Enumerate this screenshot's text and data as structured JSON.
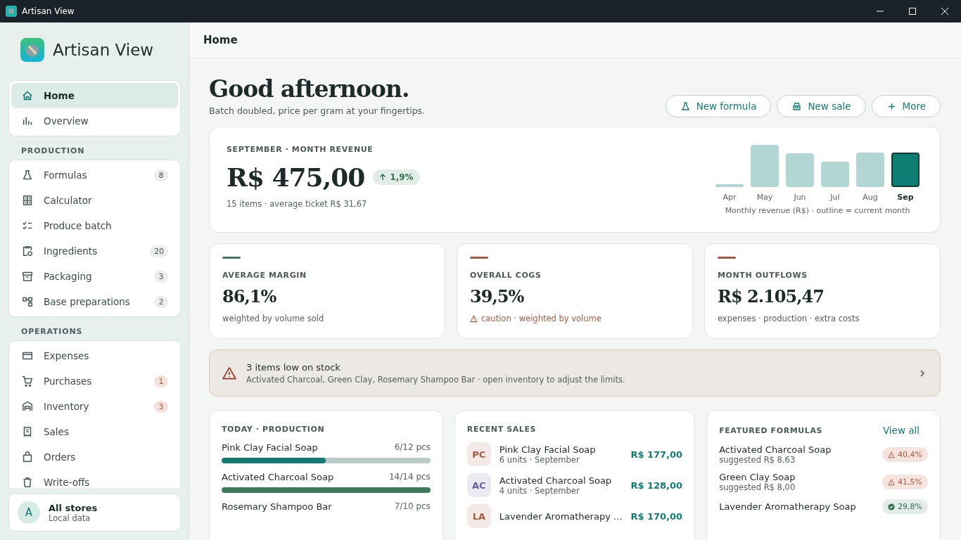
{
  "window": {
    "title": "Artisan View"
  },
  "sidebar": {
    "app_name": "Artisan View",
    "groups": [
      {
        "items": [
          {
            "label": "Home",
            "kind": "home",
            "selected": true
          },
          {
            "label": "Overview",
            "kind": "chart",
            "selected": false
          }
        ]
      },
      {
        "heading": "PRODUCTION",
        "items": [
          {
            "label": "Formulas",
            "kind": "flask",
            "selected": false,
            "count": "8",
            "alert": false
          },
          {
            "label": "Calculator",
            "kind": "calc",
            "selected": false
          },
          {
            "label": "Produce batch",
            "kind": "checklist",
            "selected": false
          },
          {
            "label": "Ingredients",
            "kind": "clipboard",
            "selected": false,
            "count": "20",
            "alert": false
          },
          {
            "label": "Packaging",
            "kind": "box",
            "selected": false,
            "count": "3",
            "alert": false
          },
          {
            "label": "Base preparations",
            "kind": "nodes",
            "selected": false,
            "count": "2",
            "alert": false
          }
        ]
      },
      {
        "heading": "OPERATIONS",
        "items": [
          {
            "label": "Expenses",
            "kind": "card",
            "selected": false
          },
          {
            "label": "Purchases",
            "kind": "cart",
            "selected": false,
            "count": "1",
            "alert": true
          },
          {
            "label": "Inventory",
            "kind": "warehouse",
            "selected": false,
            "count": "3",
            "alert": true
          },
          {
            "label": "Sales",
            "kind": "receipt",
            "selected": false
          },
          {
            "label": "Orders",
            "kind": "bag",
            "selected": false
          },
          {
            "label": "Write-offs",
            "kind": "trash",
            "selected": false
          }
        ]
      }
    ],
    "store": {
      "avatar": "A",
      "name": "All stores",
      "subtitle": "Local data"
    }
  },
  "header": {
    "title": "Home"
  },
  "greeting": {
    "title": "Good afternoon.",
    "subtitle": "Batch doubled, price per gram at your fingertips."
  },
  "actions": [
    {
      "label": "New formula",
      "kind": "flask"
    },
    {
      "label": "New sale",
      "kind": "register"
    },
    {
      "label": "More",
      "kind": "plus"
    }
  ],
  "revenue": {
    "label": "SEPTEMBER · MONTH REVENUE",
    "amount": "R$ 475,00",
    "change": "1,9%",
    "detail": "15 items · average ticket R$ 31,67",
    "months": [
      {
        "label": "Apr",
        "selected": false
      },
      {
        "label": "May",
        "selected": false
      },
      {
        "label": "Jun",
        "selected": false
      },
      {
        "label": "Jul",
        "selected": false
      },
      {
        "label": "Aug",
        "selected": false
      },
      {
        "label": "Sep",
        "selected": true
      }
    ],
    "caption": "Monthly revenue (R$) · outline = current month"
  },
  "metrics": [
    {
      "label": "AVERAGE MARGIN",
      "value": "86,1%",
      "note": "weighted by volume sold",
      "color": "#3e7a5c",
      "caution": false
    },
    {
      "label": "OVERALL COGS",
      "value": "39,5%",
      "note": "caution · weighted by volume",
      "color": "#a85a40",
      "caution": true
    },
    {
      "label": "MONTH OUTFLOWS",
      "value": "R$ 2.105,47",
      "note": "expenses · production · extra costs",
      "color": "#a85a40",
      "caution": false
    }
  ],
  "alert": {
    "title": "3 items low on stock",
    "text": "Activated Charcoal, Green Clay, Rosemary Shampoo Bar · open inventory to adjust the limits."
  },
  "production": {
    "title": "TODAY · PRODUCTION",
    "items": [
      {
        "name": "Pink Clay Facial Soap",
        "count": "6/12 pcs",
        "level": 0.5
      },
      {
        "name": "Activated Charcoal Soap",
        "count": "14/14 pcs",
        "level": 1
      },
      {
        "name": "Rosemary Shampoo Bar",
        "count": "7/10 pcs"
      }
    ]
  },
  "sales": {
    "title": "RECENT SALES",
    "items": [
      {
        "initials": "PC",
        "name": "Pink Clay Facial Soap",
        "detail": "6 units · September",
        "amount": "R$ 177,00",
        "color": "#a85a40"
      },
      {
        "initials": "AC",
        "name": "Activated Charcoal Soap",
        "detail": "4 units · September",
        "amount": "R$ 128,00",
        "color": "#6a5c9e"
      },
      {
        "initials": "LA",
        "name": "Lavender Aromatherapy ...",
        "amount": "R$ 170,00",
        "color": "#a85a40"
      }
    ]
  },
  "formulas": {
    "title": "FEATURED FORMULAS",
    "link": "View all",
    "items": [
      {
        "name": "Activated Charcoal Soap",
        "detail": "suggested R$ 8,63",
        "badge": "40,4%",
        "kind": "warn"
      },
      {
        "name": "Green Clay Soap",
        "detail": "suggested R$ 8,00",
        "badge": "41,5%",
        "kind": "warn"
      },
      {
        "name": "Lavender Aromatherapy Soap",
        "badge": "29,8%",
        "kind": "ok"
      }
    ]
  }
}
